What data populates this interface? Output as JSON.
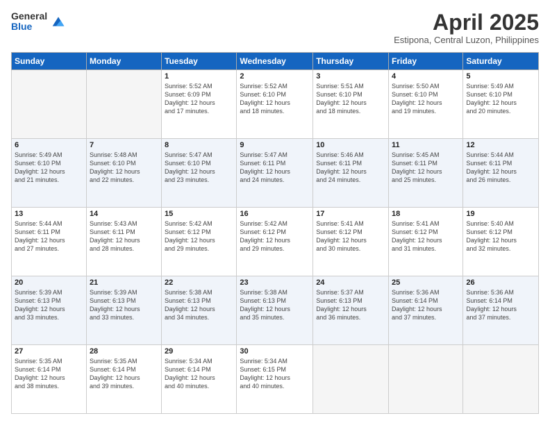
{
  "header": {
    "logo_general": "General",
    "logo_blue": "Blue",
    "title": "April 2025",
    "location": "Estipona, Central Luzon, Philippines"
  },
  "days_of_week": [
    "Sunday",
    "Monday",
    "Tuesday",
    "Wednesday",
    "Thursday",
    "Friday",
    "Saturday"
  ],
  "weeks": [
    [
      {
        "day": "",
        "empty": true
      },
      {
        "day": "",
        "empty": true
      },
      {
        "day": "1",
        "rise": "5:52 AM",
        "set": "6:09 PM",
        "daylight": "12 hours and 17 minutes."
      },
      {
        "day": "2",
        "rise": "5:52 AM",
        "set": "6:10 PM",
        "daylight": "12 hours and 18 minutes."
      },
      {
        "day": "3",
        "rise": "5:51 AM",
        "set": "6:10 PM",
        "daylight": "12 hours and 18 minutes."
      },
      {
        "day": "4",
        "rise": "5:50 AM",
        "set": "6:10 PM",
        "daylight": "12 hours and 19 minutes."
      },
      {
        "day": "5",
        "rise": "5:49 AM",
        "set": "6:10 PM",
        "daylight": "12 hours and 20 minutes."
      }
    ],
    [
      {
        "day": "6",
        "rise": "5:49 AM",
        "set": "6:10 PM",
        "daylight": "12 hours and 21 minutes."
      },
      {
        "day": "7",
        "rise": "5:48 AM",
        "set": "6:10 PM",
        "daylight": "12 hours and 22 minutes."
      },
      {
        "day": "8",
        "rise": "5:47 AM",
        "set": "6:10 PM",
        "daylight": "12 hours and 23 minutes."
      },
      {
        "day": "9",
        "rise": "5:47 AM",
        "set": "6:11 PM",
        "daylight": "12 hours and 24 minutes."
      },
      {
        "day": "10",
        "rise": "5:46 AM",
        "set": "6:11 PM",
        "daylight": "12 hours and 24 minutes."
      },
      {
        "day": "11",
        "rise": "5:45 AM",
        "set": "6:11 PM",
        "daylight": "12 hours and 25 minutes."
      },
      {
        "day": "12",
        "rise": "5:44 AM",
        "set": "6:11 PM",
        "daylight": "12 hours and 26 minutes."
      }
    ],
    [
      {
        "day": "13",
        "rise": "5:44 AM",
        "set": "6:11 PM",
        "daylight": "12 hours and 27 minutes."
      },
      {
        "day": "14",
        "rise": "5:43 AM",
        "set": "6:11 PM",
        "daylight": "12 hours and 28 minutes."
      },
      {
        "day": "15",
        "rise": "5:42 AM",
        "set": "6:12 PM",
        "daylight": "12 hours and 29 minutes."
      },
      {
        "day": "16",
        "rise": "5:42 AM",
        "set": "6:12 PM",
        "daylight": "12 hours and 29 minutes."
      },
      {
        "day": "17",
        "rise": "5:41 AM",
        "set": "6:12 PM",
        "daylight": "12 hours and 30 minutes."
      },
      {
        "day": "18",
        "rise": "5:41 AM",
        "set": "6:12 PM",
        "daylight": "12 hours and 31 minutes."
      },
      {
        "day": "19",
        "rise": "5:40 AM",
        "set": "6:12 PM",
        "daylight": "12 hours and 32 minutes."
      }
    ],
    [
      {
        "day": "20",
        "rise": "5:39 AM",
        "set": "6:13 PM",
        "daylight": "12 hours and 33 minutes."
      },
      {
        "day": "21",
        "rise": "5:39 AM",
        "set": "6:13 PM",
        "daylight": "12 hours and 33 minutes."
      },
      {
        "day": "22",
        "rise": "5:38 AM",
        "set": "6:13 PM",
        "daylight": "12 hours and 34 minutes."
      },
      {
        "day": "23",
        "rise": "5:38 AM",
        "set": "6:13 PM",
        "daylight": "12 hours and 35 minutes."
      },
      {
        "day": "24",
        "rise": "5:37 AM",
        "set": "6:13 PM",
        "daylight": "12 hours and 36 minutes."
      },
      {
        "day": "25",
        "rise": "5:36 AM",
        "set": "6:14 PM",
        "daylight": "12 hours and 37 minutes."
      },
      {
        "day": "26",
        "rise": "5:36 AM",
        "set": "6:14 PM",
        "daylight": "12 hours and 37 minutes."
      }
    ],
    [
      {
        "day": "27",
        "rise": "5:35 AM",
        "set": "6:14 PM",
        "daylight": "12 hours and 38 minutes."
      },
      {
        "day": "28",
        "rise": "5:35 AM",
        "set": "6:14 PM",
        "daylight": "12 hours and 39 minutes."
      },
      {
        "day": "29",
        "rise": "5:34 AM",
        "set": "6:14 PM",
        "daylight": "12 hours and 40 minutes."
      },
      {
        "day": "30",
        "rise": "5:34 AM",
        "set": "6:15 PM",
        "daylight": "12 hours and 40 minutes."
      },
      {
        "day": "",
        "empty": true
      },
      {
        "day": "",
        "empty": true
      },
      {
        "day": "",
        "empty": true
      }
    ]
  ],
  "labels": {
    "sunrise": "Sunrise:",
    "sunset": "Sunset:",
    "daylight": "Daylight:"
  }
}
